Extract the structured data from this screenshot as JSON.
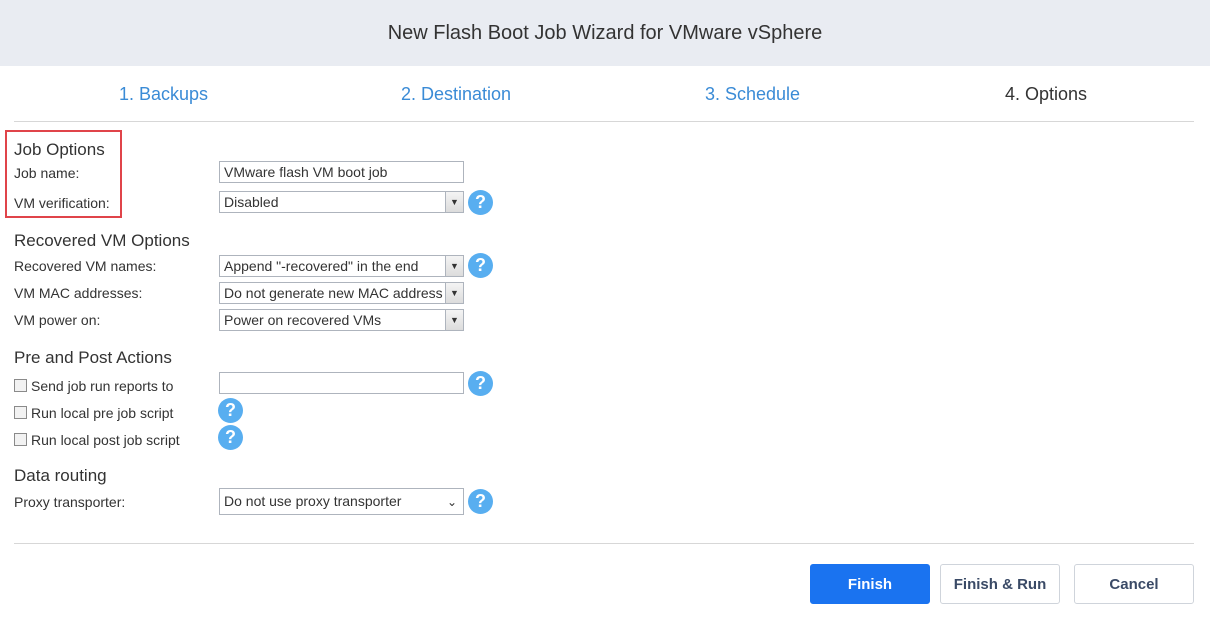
{
  "window": {
    "title": "New Flash Boot Job Wizard for VMware vSphere"
  },
  "steps": [
    {
      "label": "1. Backups"
    },
    {
      "label": "2. Destination"
    },
    {
      "label": "3. Schedule"
    },
    {
      "label": "4. Options"
    }
  ],
  "job_options": {
    "heading": "Job Options",
    "job_name_label": "Job name:",
    "job_name_value": "VMware flash VM boot job",
    "vm_verification_label": "VM verification:",
    "vm_verification_value": "Disabled"
  },
  "recovered_vm_options": {
    "heading": "Recovered VM Options",
    "names_label": "Recovered VM names:",
    "names_value": "Append \"-recovered\" in the end",
    "mac_label": "VM MAC addresses:",
    "mac_value": "Do not generate new MAC addresses",
    "power_label": "VM power on:",
    "power_value": "Power on recovered VMs"
  },
  "pre_post_actions": {
    "heading": "Pre and Post Actions",
    "send_reports_label": "Send job run reports to",
    "send_reports_value": "",
    "pre_script_label": "Run local pre job script",
    "post_script_label": "Run local post job script"
  },
  "data_routing": {
    "heading": "Data routing",
    "proxy_label": "Proxy transporter:",
    "proxy_value": "Do not use proxy transporter"
  },
  "help_glyph": "?",
  "buttons": {
    "finish": "Finish",
    "finish_run": "Finish & Run",
    "cancel": "Cancel"
  },
  "colors": {
    "accent": "#1a73f0",
    "link": "#3a8bd6",
    "help": "#58aef0",
    "highlight": "#e0444a"
  }
}
